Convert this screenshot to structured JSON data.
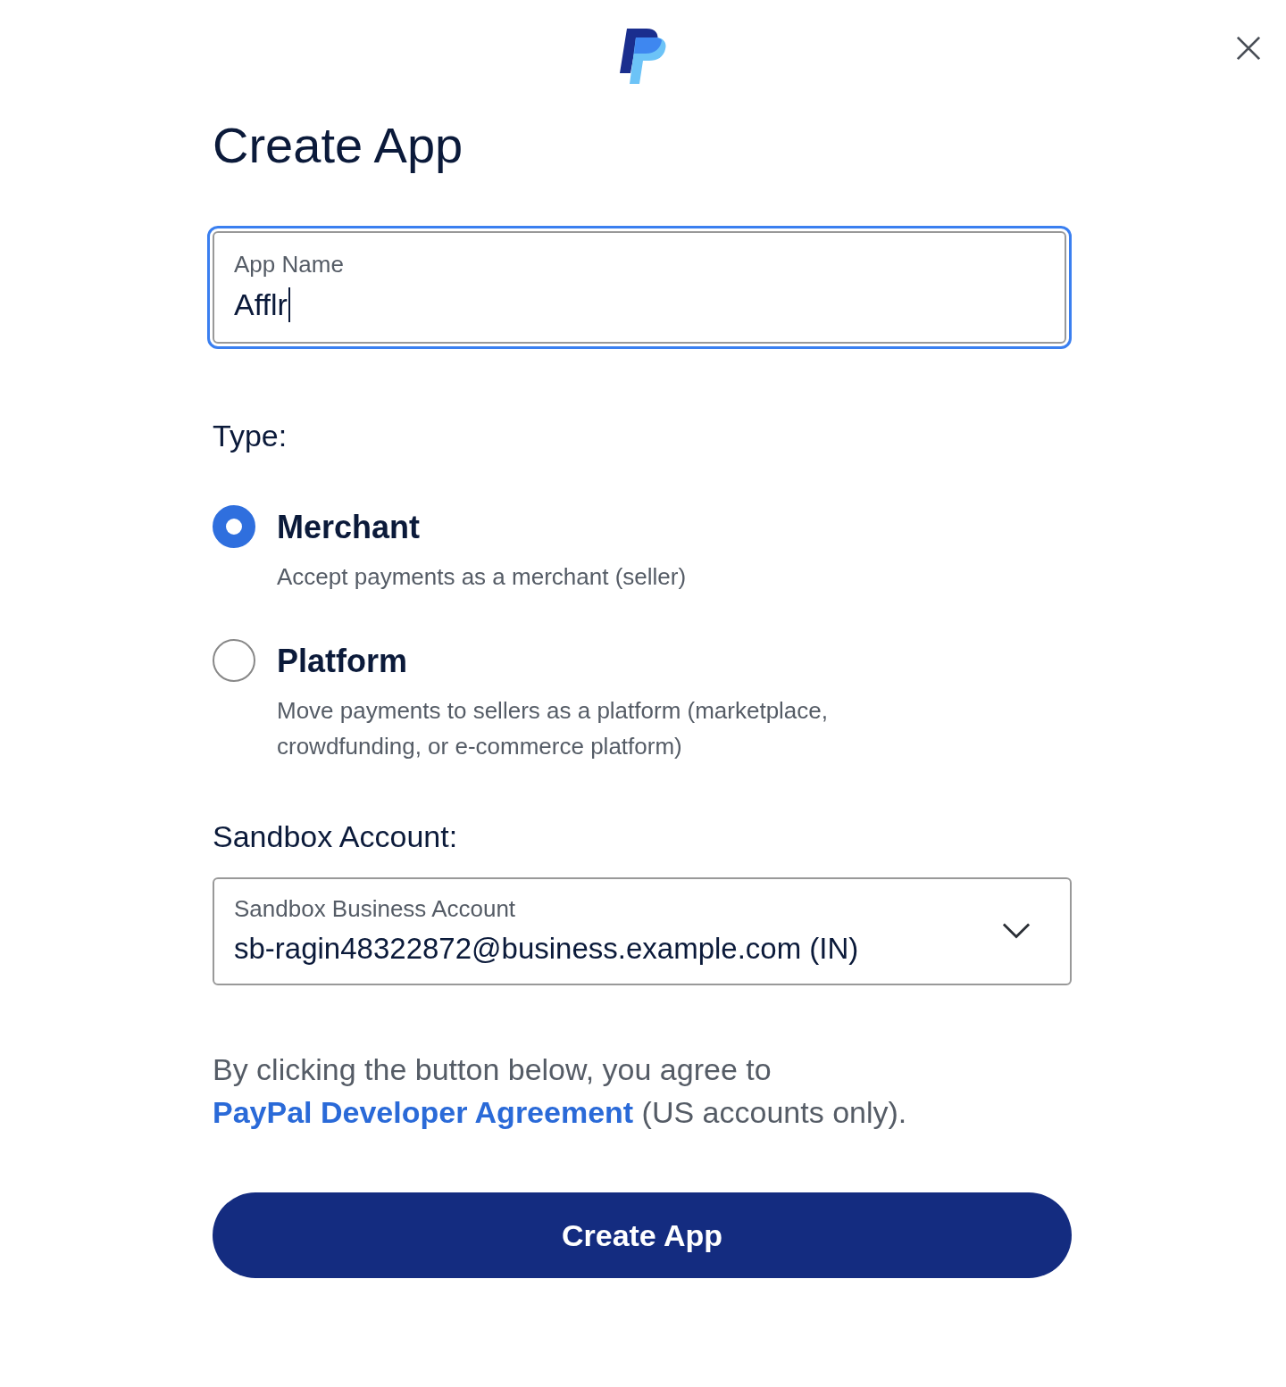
{
  "title": "Create App",
  "app_name": {
    "label": "App Name",
    "value": "Afflr",
    "focused": true
  },
  "type": {
    "label": "Type:",
    "options": [
      {
        "title": "Merchant",
        "description": "Accept payments as a merchant (seller)",
        "selected": true
      },
      {
        "title": "Platform",
        "description": "Move payments to sellers as a platform (marketplace, crowdfunding, or e-commerce platform)",
        "selected": false
      }
    ]
  },
  "sandbox": {
    "label": "Sandbox Account:",
    "field_label": "Sandbox Business Account",
    "value": "sb-ragin48322872@business.example.com (IN)"
  },
  "agreement": {
    "before": "By clicking the button below, you agree to ",
    "link": "PayPal Developer Agreement",
    "after": " (US accounts only)."
  },
  "button": "Create App"
}
